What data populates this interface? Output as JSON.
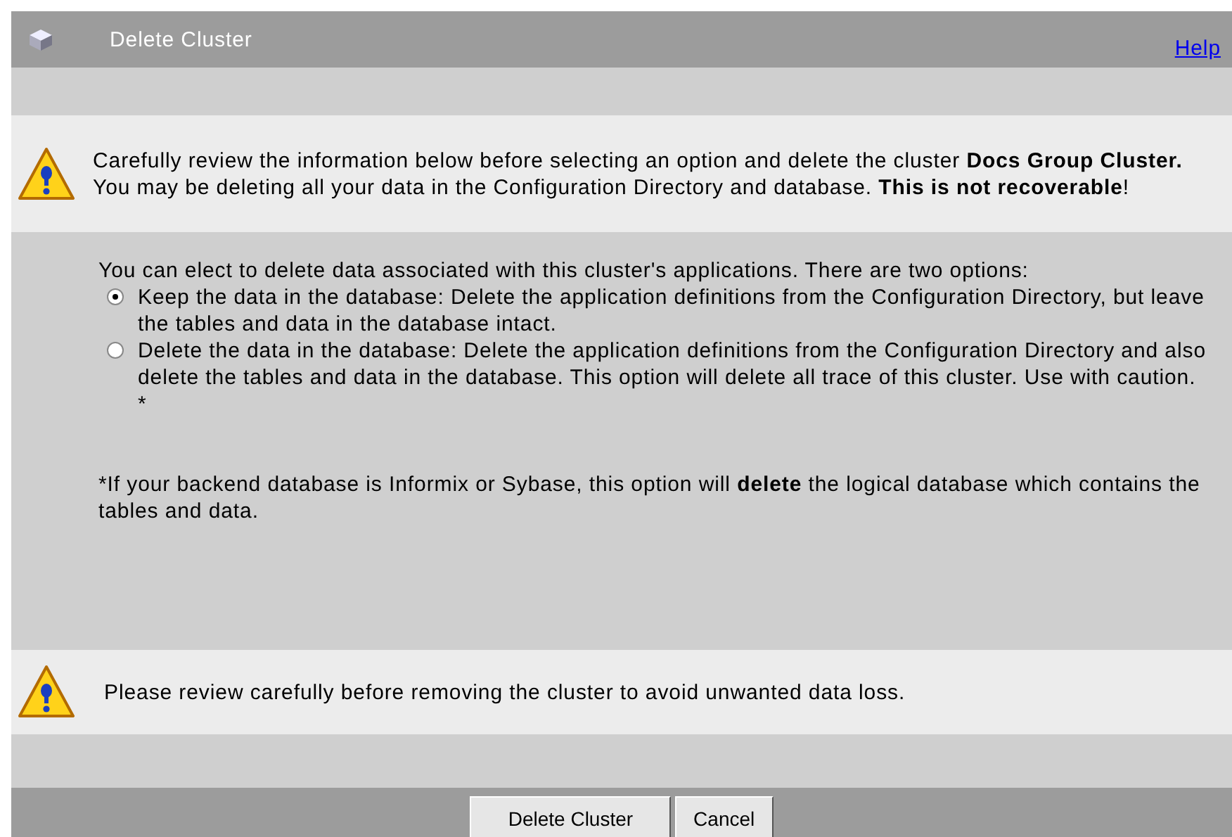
{
  "window": {
    "title": "Delete Cluster",
    "help_link": "Help"
  },
  "warning": "Carefully review the information below before selecting an option and delete the cluster **Docs Group Cluster.** You may be deleting all your data in the Configuration Directory and database. **This is not recoverable**!",
  "intro": "You can elect to delete data associated with this cluster's applications. There are two options:",
  "options": [
    {
      "label": "Keep the data in the database: Delete the application definitions from the Configuration Directory, but leave the tables and data in the database intact.",
      "selected": true
    },
    {
      "label": "Delete the data in the database: Delete the application definitions from the Configuration Directory and also delete the tables and data in the database. This option will delete all trace of this cluster. Use with caution. *",
      "selected": false
    }
  ],
  "footnote": "*If your backend database is Informix or Sybase, this option will **delete** the logical database which contains the tables and data.",
  "notice": "Please review carefully before removing the cluster to avoid unwanted data loss.",
  "buttons": [
    "Delete Cluster",
    "Cancel"
  ]
}
